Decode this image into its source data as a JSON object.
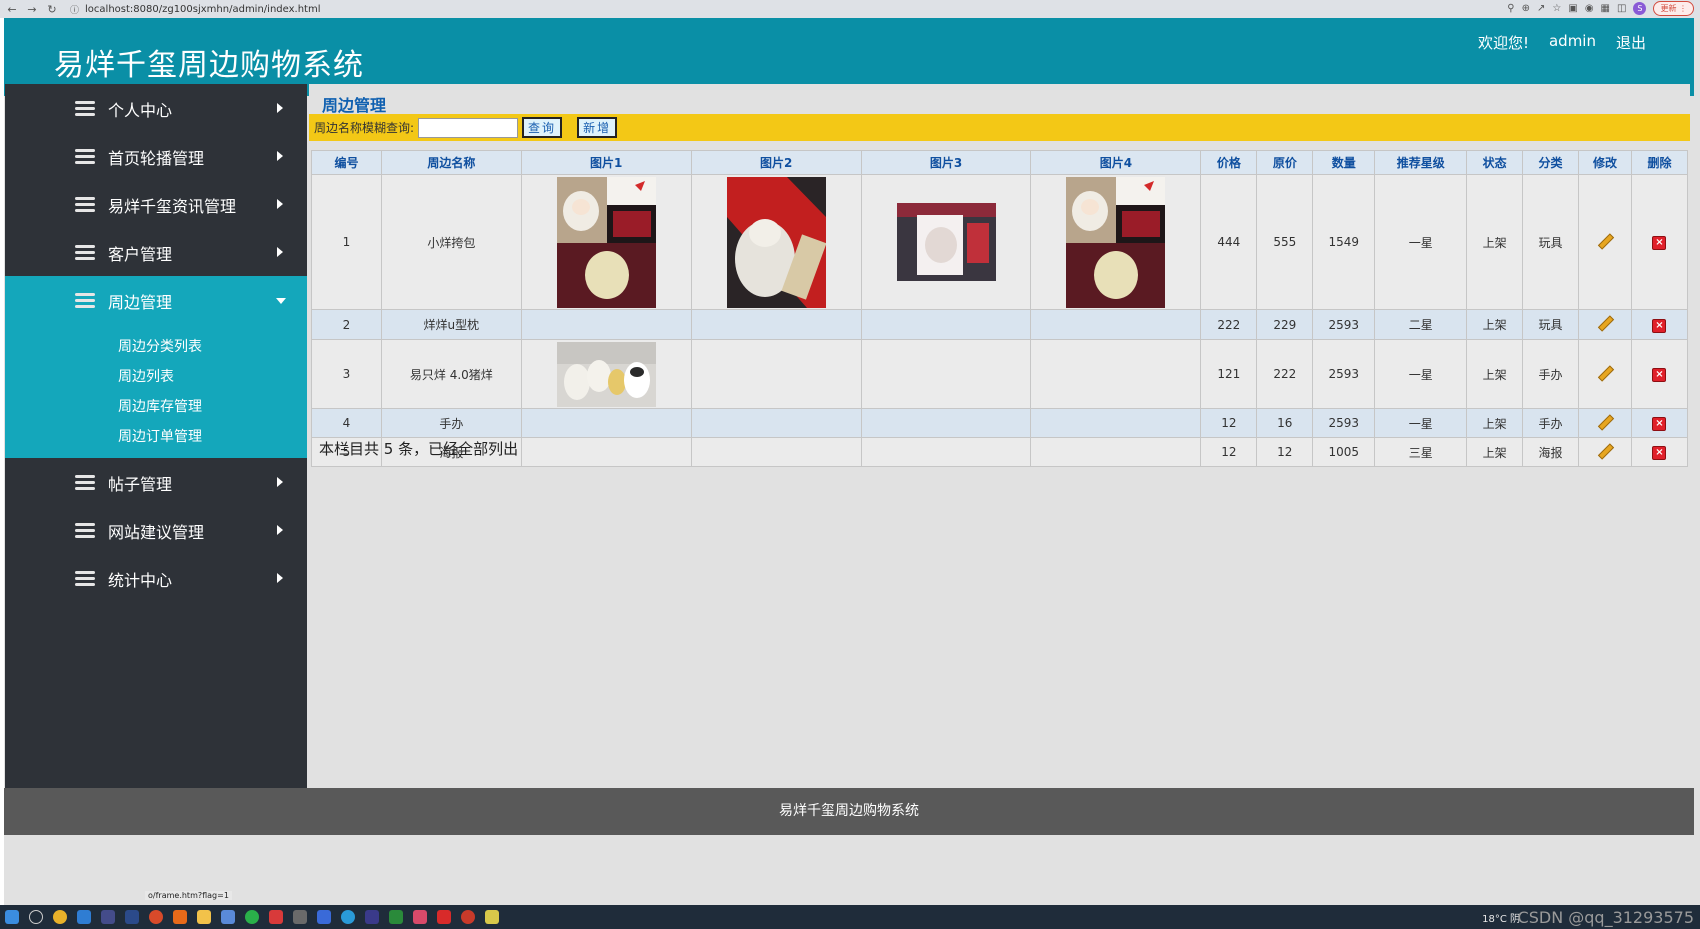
{
  "browser": {
    "url": "localhost:8080/zg100sjxmhn/admin/index.html",
    "update_label": "更新",
    "profile_initial": "S"
  },
  "header": {
    "brand": "易烊千玺周边购物系统",
    "welcome": "欢迎您!",
    "user": "admin",
    "logout": "退出"
  },
  "sidebar": {
    "items": [
      {
        "label": "个人中心"
      },
      {
        "label": "首页轮播管理"
      },
      {
        "label": "易烊千玺资讯管理"
      },
      {
        "label": "客户管理"
      },
      {
        "label": "周边管理"
      },
      {
        "label": "帖子管理"
      },
      {
        "label": "网站建议管理"
      },
      {
        "label": "统计中心"
      }
    ],
    "submenu": [
      {
        "label": "周边分类列表"
      },
      {
        "label": "周边列表"
      },
      {
        "label": "周边库存管理"
      },
      {
        "label": "周边订单管理"
      }
    ]
  },
  "main": {
    "title": "周边管理",
    "search_label": "周边名称模糊查询:",
    "search_value": "",
    "search_button": "查询",
    "add_button": "新增",
    "columns": [
      "编号",
      "周边名称",
      "图片1",
      "图片2",
      "图片3",
      "图片4",
      "价格",
      "原价",
      "数量",
      "推荐星级",
      "状态",
      "分类",
      "修改",
      "删除"
    ],
    "rows": [
      {
        "id": "1",
        "name": "小烊挎包",
        "price": "444",
        "original": "555",
        "qty": "1549",
        "stars": "一星",
        "status": "上架",
        "category": "玩具"
      },
      {
        "id": "2",
        "name": "烊烊u型枕",
        "price": "222",
        "original": "229",
        "qty": "2593",
        "stars": "二星",
        "status": "上架",
        "category": "玩具"
      },
      {
        "id": "3",
        "name": "易只烊 4.0猪烊",
        "price": "121",
        "original": "222",
        "qty": "2593",
        "stars": "一星",
        "status": "上架",
        "category": "手办"
      },
      {
        "id": "4",
        "name": "手办",
        "price": "12",
        "original": "16",
        "qty": "2593",
        "stars": "一星",
        "status": "上架",
        "category": "手办"
      },
      {
        "id": "5",
        "name": "海报",
        "price": "12",
        "original": "12",
        "qty": "1005",
        "stars": "三星",
        "status": "上架",
        "category": "海报"
      }
    ],
    "summary": "本栏目共 5 条，已经全部列出"
  },
  "footer": {
    "text": "易烊千玺周边购物系统",
    "status_link": "o/frame.htm?flag=1"
  },
  "taskbar": {
    "weather": "18°C 阴",
    "watermark": "CSDN @qq_31293575"
  }
}
